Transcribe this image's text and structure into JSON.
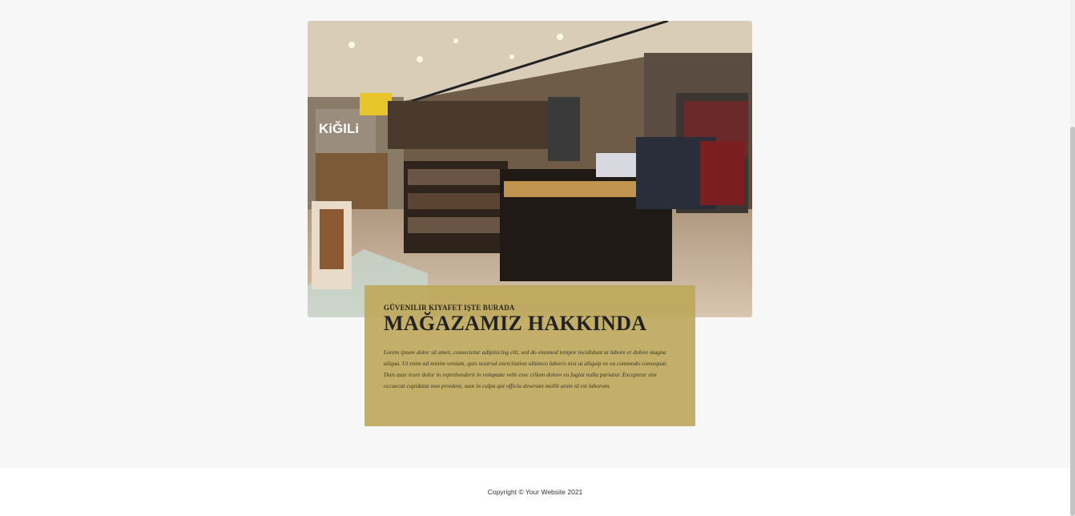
{
  "about": {
    "subtitle": "GÜVENILIR KIYAFET IŞTE BURADA",
    "title": "MAĞAZAMIZ HAKKINDA",
    "body": "Lorem ipsum dolor sit amet, consectetur adipisicing elit, sed do eiusmod tempor incididunt ut labore et dolore magna aliqua. Ut enim ad minim veniam, quis nostrud exercitation ullamco laboris nisi ut aliquip ex ea commodo consequat. Duis aute irure dolor in reprehenderit in voluptate velit esse cillum dolore eu fugiat nulla pariatur. Excepteur sint occaecat cupidatat non proident, sunt in culpa qui officia deserunt mollit anim id est laborum."
  },
  "store_photo": {
    "brand_sign": "KiĞILi"
  },
  "footer": {
    "copyright": "Copyright © Your Website 2021"
  }
}
